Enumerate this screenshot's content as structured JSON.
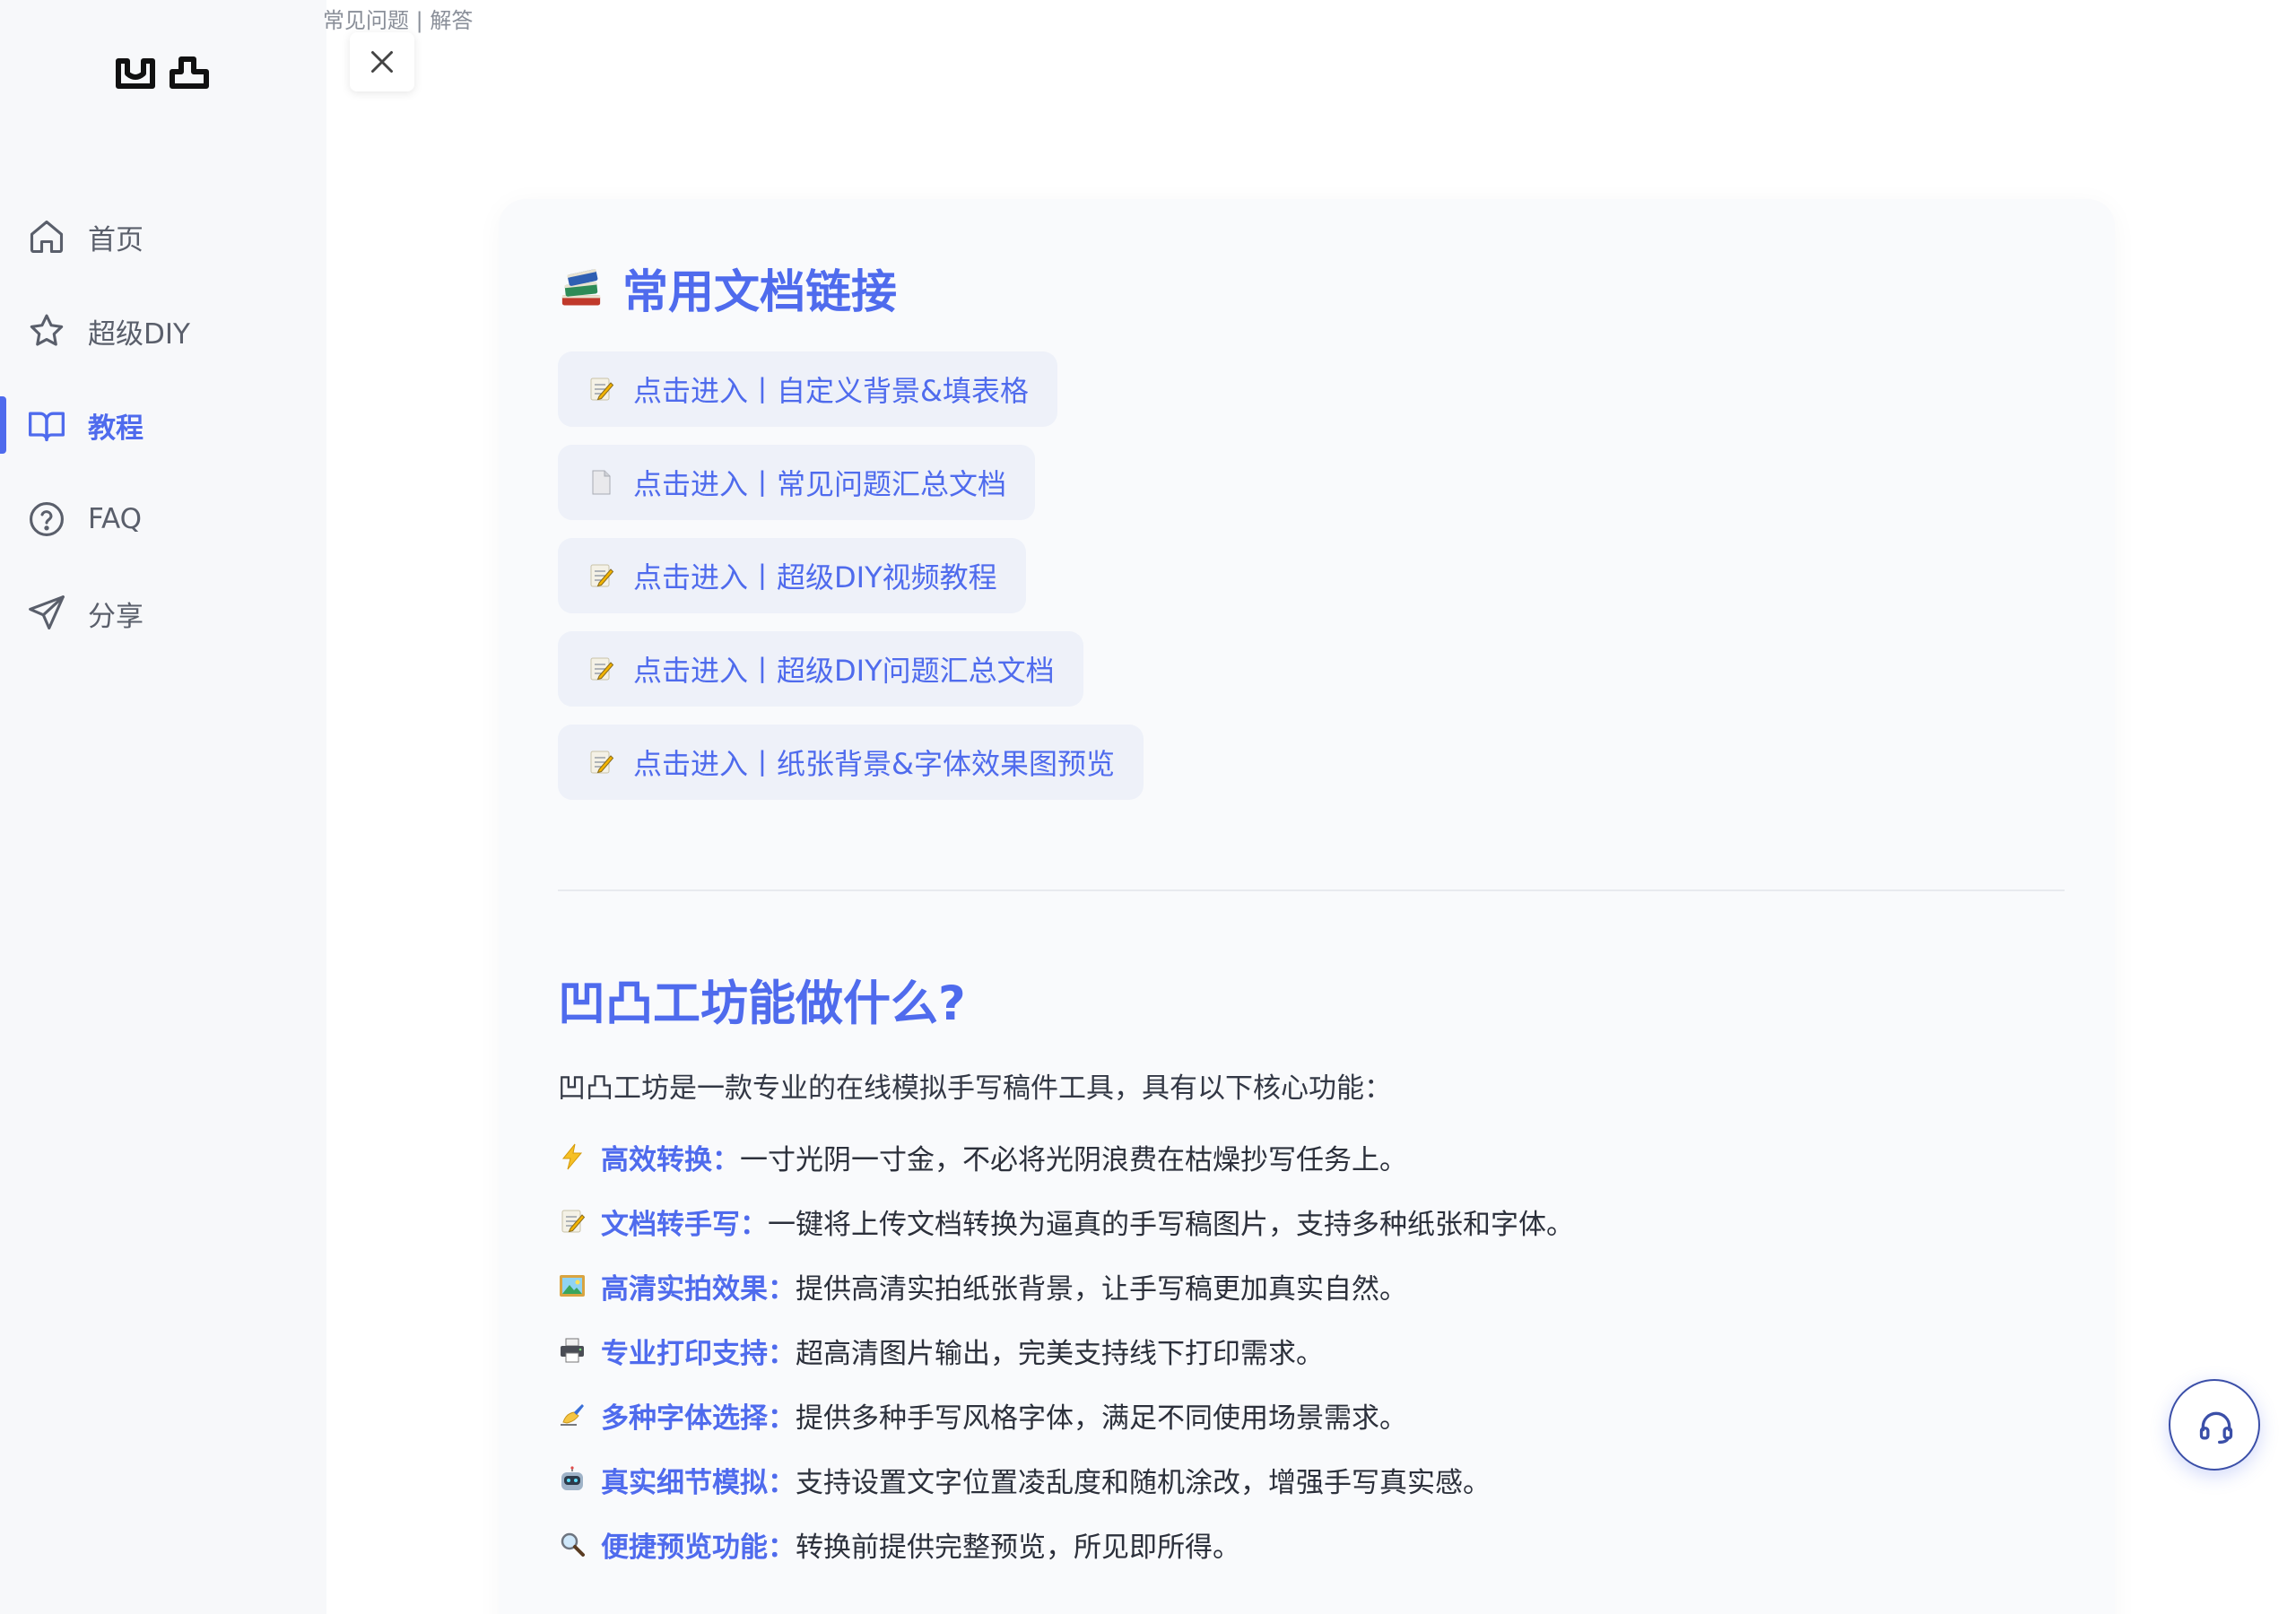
{
  "sidebar": {
    "logo_icon": "aotu-logo-icon",
    "items": [
      {
        "label": "首页",
        "icon": "home-icon",
        "active": false
      },
      {
        "label": "超级DIY",
        "icon": "star-icon",
        "active": false
      },
      {
        "label": "教程",
        "icon": "book-open-icon",
        "active": true
      },
      {
        "label": "FAQ",
        "icon": "help-circle-icon",
        "active": false
      },
      {
        "label": "分享",
        "icon": "send-icon",
        "active": false
      }
    ]
  },
  "drawer": {
    "title": "常见问题 | 解答",
    "close_icon": "close-icon"
  },
  "docs": {
    "title": "常用文档链接",
    "title_icon": "books-icon",
    "links": [
      {
        "label": "点击进入丨自定义背景&填表格",
        "icon": "memo-icon"
      },
      {
        "label": "点击进入丨常见问题汇总文档",
        "icon": "page-icon"
      },
      {
        "label": "点击进入丨超级DIY视频教程",
        "icon": "memo-icon"
      },
      {
        "label": "点击进入丨超级DIY问题汇总文档",
        "icon": "memo-icon"
      },
      {
        "label": "点击进入丨纸张背景&字体效果图预览",
        "icon": "memo-icon"
      }
    ]
  },
  "about": {
    "heading": "凹凸工坊能做什么?",
    "intro": "凹凸工坊是一款专业的在线模拟手写稿件工具，具有以下核心功能：",
    "features": [
      {
        "icon": "lightning-icon",
        "name": "高效转换：",
        "desc": "一寸光阴一寸金，不必将光阴浪费在枯燥抄写任务上。"
      },
      {
        "icon": "memo-icon",
        "name": "文档转手写：",
        "desc": "一键将上传文档转换为逼真的手写稿图片，支持多种纸张和字体。"
      },
      {
        "icon": "picture-icon",
        "name": "高清实拍效果：",
        "desc": "提供高清实拍纸张背景，让手写稿更加真实自然。"
      },
      {
        "icon": "printer-icon",
        "name": "专业打印支持：",
        "desc": "超高清图片输出，完美支持线下打印需求。"
      },
      {
        "icon": "writing-hand-icon",
        "name": "多种字体选择：",
        "desc": "提供多种手写风格字体，满足不同使用场景需求。"
      },
      {
        "icon": "robot-icon",
        "name": "真实细节模拟：",
        "desc": "支持设置文字位置凌乱度和随机涂改，增强手写真实感。"
      },
      {
        "icon": "magnifier-icon",
        "name": "便捷预览功能：",
        "desc": "转换前提供完整预览，所见即所得。"
      }
    ]
  },
  "support": {
    "icon": "headset-icon"
  },
  "colors": {
    "accent": "#4f6bed",
    "sidebar_bg": "#f7f8fa",
    "card_bg": "#f9fafc",
    "link_bg": "#eef1f9"
  }
}
